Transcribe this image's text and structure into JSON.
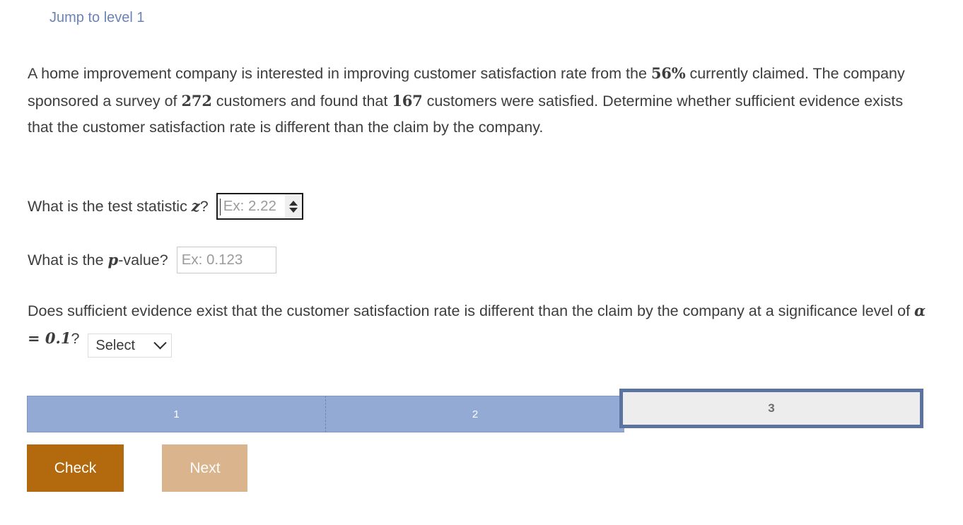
{
  "jump_link": {
    "label": "Jump to level 1"
  },
  "problem": {
    "text_part1": "A home improvement company is interested in improving customer satisfaction rate from the ",
    "claimed_rate": "56%",
    "text_part2": " currently claimed. The company sponsored a survey of ",
    "sample_size": "272",
    "text_part3": " customers and found that ",
    "satisfied_count": "167",
    "text_part4": " customers were satisfied. Determine whether sufficient evidence exists that the customer satisfaction rate is different than the claim by the company."
  },
  "question_z": {
    "label_before": "What is the test statistic ",
    "symbol": "z",
    "label_after": "?",
    "input_placeholder": "Ex: 2.22",
    "input_value": ""
  },
  "question_p": {
    "label_before": "What is the ",
    "symbol": "p",
    "label_after": "-value?",
    "input_placeholder": "Ex: 0.123",
    "input_value": ""
  },
  "question_conclusion": {
    "text_before": "Does sufficient evidence exist that the customer satisfaction rate is different than the claim by the company at a significance level of ",
    "alpha_expression": "α = 0.1",
    "text_after": "?",
    "select_value": "Select"
  },
  "progress": {
    "segments": [
      {
        "label": "1",
        "state": "completed"
      },
      {
        "label": "2",
        "state": "completed"
      },
      {
        "label": "3",
        "state": "current"
      }
    ]
  },
  "buttons": {
    "check": "Check",
    "next": "Next"
  },
  "colors": {
    "link": "#6b84b4",
    "progress_done": "#93aad4",
    "progress_current_border": "#5c73a0",
    "check_button": "#b3690e",
    "next_button": "#d9b48c"
  }
}
